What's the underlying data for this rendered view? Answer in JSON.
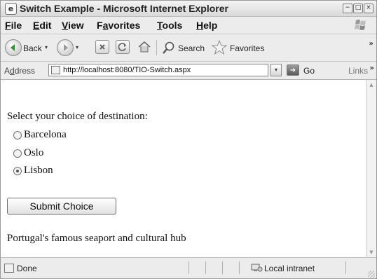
{
  "window": {
    "title": "Switch Example - Microsoft Internet Explorer",
    "buttons": {
      "minimize": "−",
      "maximize": "□",
      "close": "×"
    }
  },
  "menu": [
    {
      "underline": "F",
      "rest": "ile"
    },
    {
      "underline": "E",
      "rest": "dit"
    },
    {
      "underline": "V",
      "rest": "iew"
    },
    {
      "underline": "a",
      "prefix": "F",
      "rest": "vorites"
    },
    {
      "underline": "T",
      "rest": "ools"
    },
    {
      "underline": "H",
      "rest": "elp"
    }
  ],
  "toolbar": {
    "back_label": "Back",
    "search_label": "Search",
    "favorites_label": "Favorites",
    "more": "»",
    "dropdown": "▾"
  },
  "address": {
    "label_underline": "d",
    "label_prefix": "A",
    "label_rest": "dress",
    "url": "http://localhost:8080/TIO-Switch.aspx",
    "go_label": "Go",
    "links_label": "Links",
    "more": "»"
  },
  "content": {
    "prompt": "Select your choice of destination:",
    "options": [
      {
        "label": "Barcelona",
        "selected": false
      },
      {
        "label": "Oslo",
        "selected": false
      },
      {
        "label": "Lisbon",
        "selected": true
      }
    ],
    "submit_label": "Submit Choice",
    "result": "Portugal's famous seaport and cultural hub"
  },
  "status": {
    "text": "Done",
    "zone": "Local intranet"
  },
  "colors": {
    "chrome": "#ececec",
    "content_bg": "#ffffff",
    "back_arrow": "#3a8a3a"
  },
  "icons": {
    "app": "ie-page-icon",
    "back": "back-arrow-icon",
    "forward": "forward-arrow-icon",
    "stop": "stop-icon",
    "refresh": "refresh-icon",
    "home": "home-icon",
    "search": "magnifier-icon",
    "favorites": "star-icon"
  }
}
